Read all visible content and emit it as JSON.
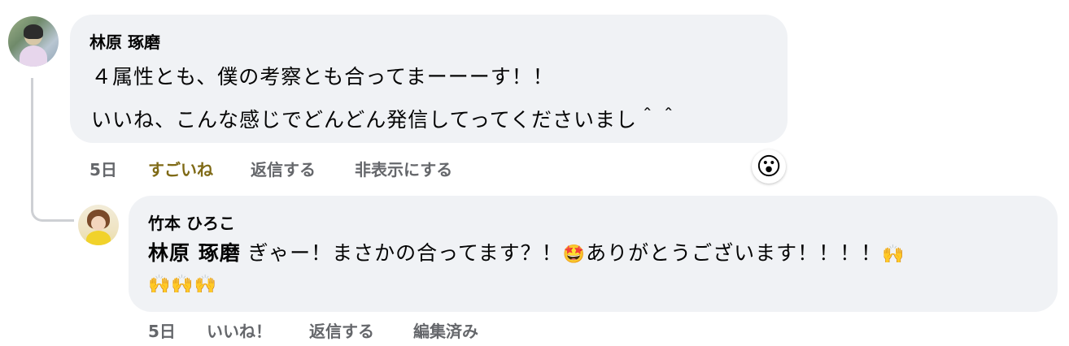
{
  "comment": {
    "author": "林原 琢磨",
    "line1": "４属性とも、僕の考察とも合ってまーーーす！！",
    "line2": "いいね、こんな感じでどんどん発信してってくださいまし＾＾",
    "time": "5日",
    "like_label": "すごいね",
    "reply_label": "返信する",
    "hide_label": "非表示にする",
    "reaction_emoji": "😮"
  },
  "reply": {
    "author": "竹本 ひろこ",
    "mention": "林原 琢磨",
    "text_part1": "ぎゃー！まさかの合ってます？！",
    "emoji1": "🤩",
    "text_part2": "ありがとうございます！！！！",
    "emoji2": "🙌",
    "line2_emojis": "🙌🙌🙌",
    "time": "5日",
    "like_label": "いいね！",
    "reply_label": "返信する",
    "edited_label": "編集済み"
  },
  "colors": {
    "bubble": "#f0f2f5",
    "meta_text": "#65676b",
    "liked_text": "#7f6a16",
    "thread_line": "#ced0d4"
  }
}
